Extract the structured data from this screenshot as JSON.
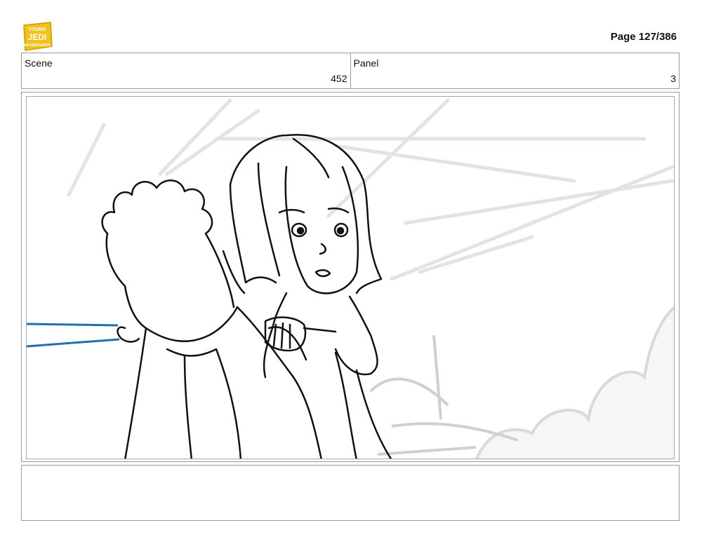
{
  "logo": {
    "lines": [
      "YOUNG",
      "JEDI",
      "ADVENTURES"
    ],
    "color": "#f2c21b"
  },
  "page": {
    "label": "Page 127/386"
  },
  "header": {
    "scene_label": "Scene",
    "scene_value": "452",
    "panel_label": "Panel",
    "panel_value": "3"
  },
  "drawing": {
    "subject": "storyboard-sketch",
    "accent_color": "#1f6fb5"
  },
  "notes": {
    "text": ""
  }
}
